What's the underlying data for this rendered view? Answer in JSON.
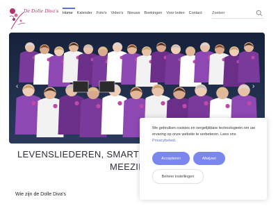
{
  "logo": {
    "text": "De Dolle Diva's",
    "icon": "flower-logo-icon"
  },
  "nav": {
    "items": [
      "Home",
      "Kalender",
      "Foto's",
      "Video's",
      "Nieuws",
      "Boekingen",
      "Voor leden",
      "Contact"
    ],
    "active": "Home"
  },
  "search": {
    "label": "Zoeken",
    "icon": "search-icon"
  },
  "hero": {
    "image": "group-photo-choir-in-purple",
    "prev_icon": "chevron-left-icon",
    "next_icon": "chevron-right-icon"
  },
  "headline": {
    "line1": "LEVENSLIEDEREN, SMARTLAP",
    "line2": "MEEZIN"
  },
  "subhead": "Wie zijn de Dolle Diva's",
  "cookie": {
    "text": "We gebruiken cookies en vergelijkbare technologieën om uw ervaring op onze website te verbeteren. Lees ons",
    "link": "Privacybeleid",
    "accept": "Accepteren",
    "reject": "Afwijzen",
    "manage": "Beheer instellingen"
  },
  "colors": {
    "accent": "#7b86ef",
    "brand": "#b0316e",
    "purple": "#7a3a9c"
  }
}
